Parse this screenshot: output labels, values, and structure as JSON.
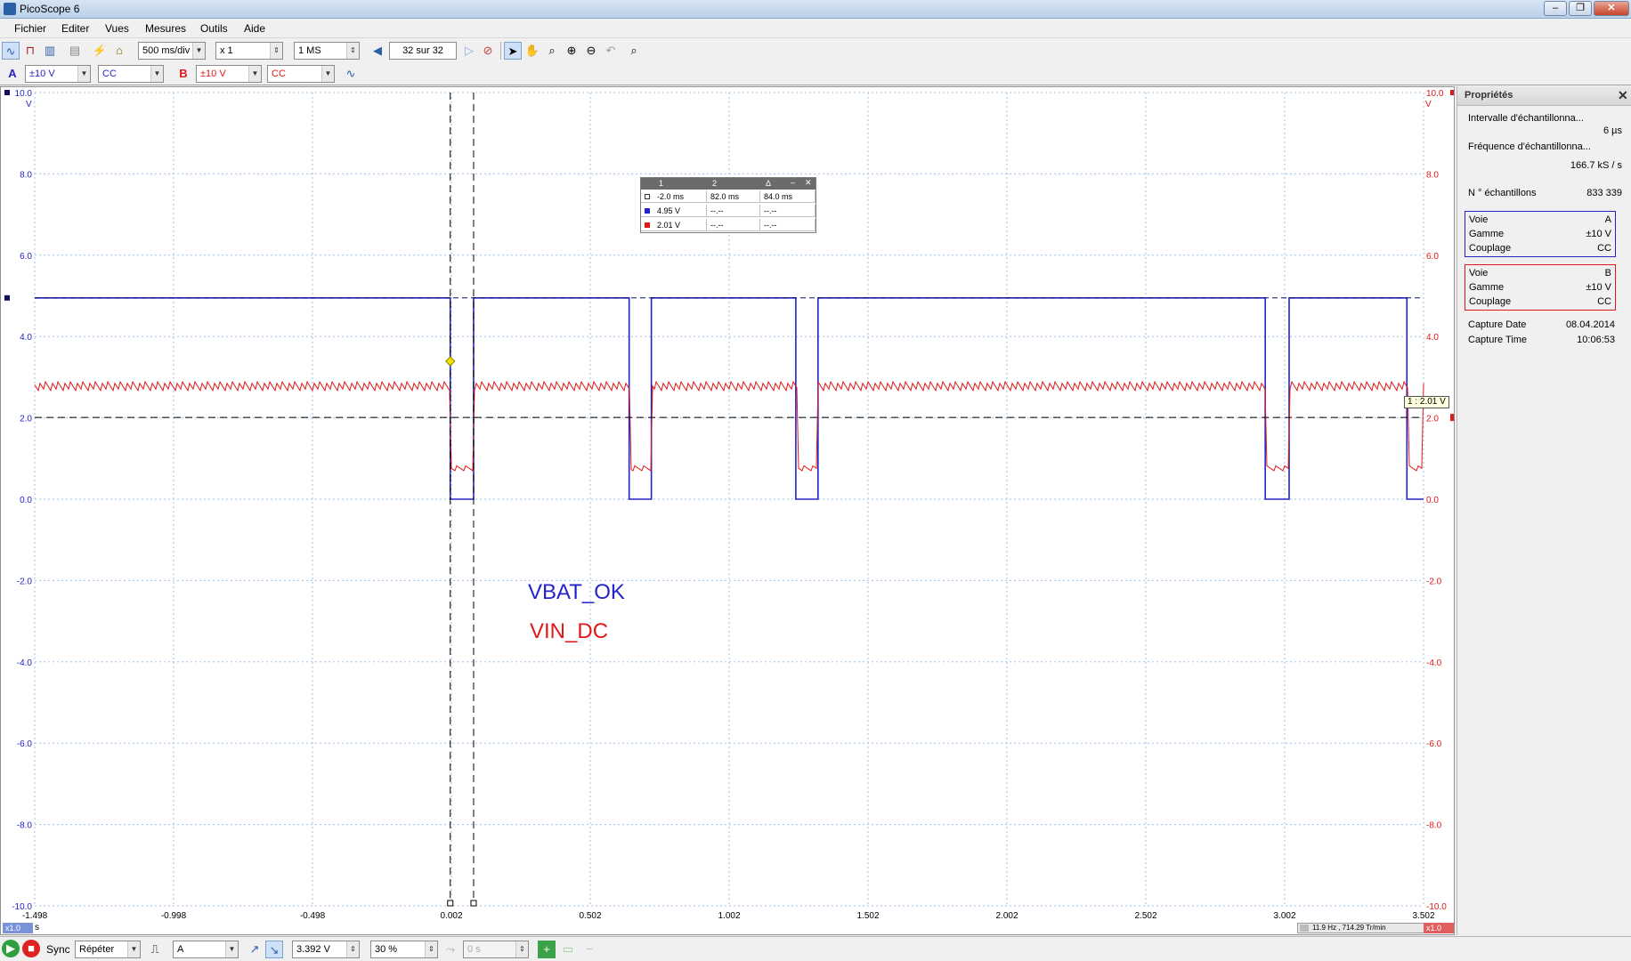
{
  "window": {
    "title": "PicoScope 6",
    "minimize": "–",
    "maximize": "❐",
    "close": "✕"
  },
  "menu": [
    "Fichier",
    "Editer",
    "Vues",
    "Mesures",
    "Outils",
    "Aide"
  ],
  "toolbar": {
    "timebase": "500 ms/div",
    "zoom": "x 1",
    "samples": "1 MS",
    "buffer": "32 sur 32"
  },
  "channels": {
    "a": {
      "label": "A",
      "range": "±10 V",
      "coupling": "CC",
      "color": "#2323c8"
    },
    "b": {
      "label": "B",
      "range": "±10 V",
      "coupling": "CC",
      "color": "#e01818"
    }
  },
  "scope": {
    "y_ticks": [
      "10.0",
      "8.0",
      "6.0",
      "4.0",
      "2.0",
      "0.0",
      "-2.0",
      "-4.0",
      "-6.0",
      "-8.0",
      "-10.0"
    ],
    "unit_left": "V",
    "unit_right": "V",
    "x_ticks": [
      "-1.498",
      "-0.998",
      "-0.498",
      "0.002",
      "0.502",
      "1.002",
      "1.502",
      "2.002",
      "2.502",
      "3.002",
      "3.502"
    ],
    "x_unit": "s",
    "x_zoom": "x1.0",
    "label_a": "VBAT_OK",
    "label_b": "VIN_DC",
    "ruler_tag": "1 : 2.01 V",
    "freq_readout": "11.9 Hz , 714.29 Tr/min"
  },
  "measurements": {
    "headers": [
      "1",
      "2",
      "Δ"
    ],
    "rows": [
      [
        "-2.0 ms",
        "82.0 ms",
        "84.0 ms"
      ],
      [
        "4.95 V",
        "--.--",
        "--.--"
      ],
      [
        "2.01 V",
        "--.--",
        "--.--"
      ]
    ]
  },
  "properties": {
    "title": "Propriétés",
    "interval_label": "Intervalle d'échantillonna...",
    "interval_value": "6 µs",
    "freq_label": "Fréquence d'échantillonna...",
    "freq_value": "166.7 kS / s",
    "nsamples_label": "N ° échantillons",
    "nsamples_value": "833 339",
    "ch_a": {
      "voie_label": "Voie",
      "voie": "A",
      "gamme_label": "Gamme",
      "gamme": "±10 V",
      "couplage_label": "Couplage",
      "couplage": "CC"
    },
    "ch_b": {
      "voie_label": "Voie",
      "voie": "B",
      "gamme_label": "Gamme",
      "gamme": "±10 V",
      "couplage_label": "Couplage",
      "couplage": "CC"
    },
    "capture_date_label": "Capture Date",
    "capture_date": "08.04.2014",
    "capture_time_label": "Capture Time",
    "capture_time": "10:06:53"
  },
  "statusbar": {
    "sync": "Sync",
    "mode": "Répéter",
    "trigger_source": "A",
    "trigger_level": "3.392 V",
    "pretrigger": "30 %",
    "delay": "0 s"
  }
}
